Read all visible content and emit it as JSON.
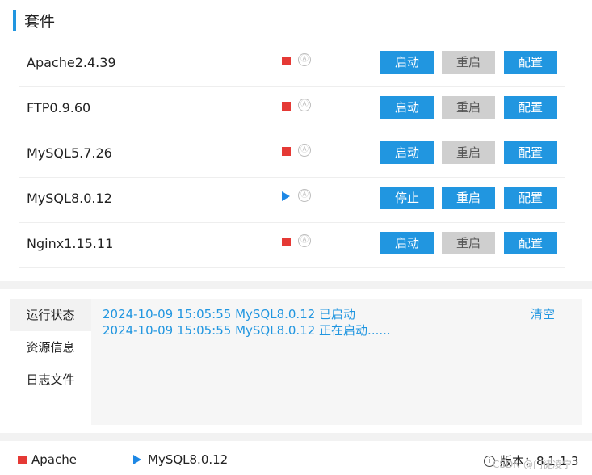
{
  "section": {
    "title": "套件"
  },
  "services": [
    {
      "name": "Apache2.4.39",
      "status": "stopped",
      "action": "启动",
      "restart": "重启",
      "config": "配置"
    },
    {
      "name": "FTP0.9.60",
      "status": "stopped",
      "action": "启动",
      "restart": "重启",
      "config": "配置"
    },
    {
      "name": "MySQL5.7.26",
      "status": "stopped",
      "action": "启动",
      "restart": "重启",
      "config": "配置"
    },
    {
      "name": "MySQL8.0.12",
      "status": "running",
      "action": "停止",
      "restart": "重启",
      "config": "配置"
    },
    {
      "name": "Nginx1.15.11",
      "status": "stopped",
      "action": "启动",
      "restart": "重启",
      "config": "配置"
    }
  ],
  "auto_icon_glyph": "Ⓐ",
  "tabs": [
    {
      "label": "运行状态",
      "active": true
    },
    {
      "label": "资源信息",
      "active": false
    },
    {
      "label": "日志文件",
      "active": false
    }
  ],
  "log": {
    "lines": [
      "2024-10-09 15:05:55 MySQL8.0.12 已启动",
      "2024-10-09 15:05:55 MySQL8.0.12 正在启动......"
    ],
    "clear_label": "清空"
  },
  "footer": {
    "apache": "Apache",
    "mysql": "MySQL8.0.12",
    "version": "版本：8.1.1.3",
    "watermark": "CSDN @门徒凌宁"
  },
  "colors": {
    "accent": "#2196e0",
    "stopped": "#e53935",
    "running": "#1e88e5",
    "disabled_button": "#cfcfcf"
  }
}
